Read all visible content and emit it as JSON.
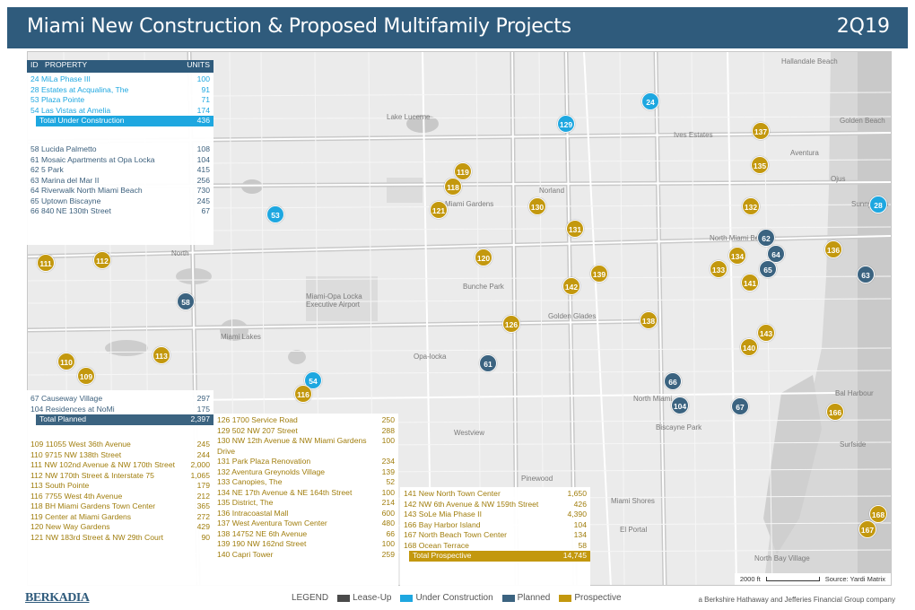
{
  "header": {
    "title": "Miami New Construction & Proposed Multifamily Projects",
    "quarter": "2Q19"
  },
  "map": {
    "places": [
      "Hallandale Beach",
      "Lake Lucerne",
      "Ives Estates",
      "Golden Beach",
      "Aventura",
      "Norland",
      "Ojus",
      "Miami Gardens",
      "Sunny Isles",
      "North Miami Beach",
      "North",
      "Bunche Park",
      "Golden Glades",
      "Miami-Opa Locka Executive Airport",
      "Miami Lakes",
      "Opa-locka",
      "Westview",
      "North Miami",
      "Biscayne Park",
      "Bal Harbour",
      "Surfside",
      "Pinewood",
      "Miami Shores",
      "El Portal",
      "North Bay Village"
    ],
    "pins": [
      {
        "id": "24",
        "status": "uc"
      },
      {
        "id": "129",
        "status": "uc"
      },
      {
        "id": "137",
        "status": "pr"
      },
      {
        "id": "135",
        "status": "pr"
      },
      {
        "id": "119",
        "status": "pr"
      },
      {
        "id": "118",
        "status": "pr"
      },
      {
        "id": "53",
        "status": "uc"
      },
      {
        "id": "121",
        "status": "pr"
      },
      {
        "id": "130",
        "status": "pr"
      },
      {
        "id": "132",
        "status": "pr"
      },
      {
        "id": "28",
        "status": "uc"
      },
      {
        "id": "131",
        "status": "pr"
      },
      {
        "id": "62",
        "status": "pl"
      },
      {
        "id": "111",
        "status": "pr"
      },
      {
        "id": "112",
        "status": "pr"
      },
      {
        "id": "120",
        "status": "pr"
      },
      {
        "id": "134",
        "status": "pr"
      },
      {
        "id": "64",
        "status": "pl"
      },
      {
        "id": "136",
        "status": "pr"
      },
      {
        "id": "133",
        "status": "pr"
      },
      {
        "id": "65",
        "status": "pl"
      },
      {
        "id": "63",
        "status": "pl"
      },
      {
        "id": "139",
        "status": "pr"
      },
      {
        "id": "142",
        "status": "pr"
      },
      {
        "id": "141",
        "status": "pr"
      },
      {
        "id": "58",
        "status": "pl"
      },
      {
        "id": "126",
        "status": "pr"
      },
      {
        "id": "138",
        "status": "pr"
      },
      {
        "id": "143",
        "status": "pr"
      },
      {
        "id": "140",
        "status": "pr"
      },
      {
        "id": "110",
        "status": "pr"
      },
      {
        "id": "113",
        "status": "pr"
      },
      {
        "id": "61",
        "status": "pl"
      },
      {
        "id": "109",
        "status": "pr"
      },
      {
        "id": "54",
        "status": "uc"
      },
      {
        "id": "66",
        "status": "pl"
      },
      {
        "id": "116",
        "status": "pr"
      },
      {
        "id": "104",
        "status": "pl"
      },
      {
        "id": "67",
        "status": "pl"
      },
      {
        "id": "166",
        "status": "pr"
      },
      {
        "id": "168",
        "status": "pr"
      },
      {
        "id": "167",
        "status": "pr"
      }
    ],
    "scale": {
      "label": "2000 ft",
      "source": "Source: Yardi Matrix"
    }
  },
  "table_top": {
    "columns": {
      "id": "ID",
      "property": "PROPERTY",
      "units": "UNITS"
    },
    "under_construction": [
      {
        "id": "24",
        "name": "MiLa Phase III",
        "units": "100"
      },
      {
        "id": "28",
        "name": "Estates at Acqualina, The",
        "units": "91"
      },
      {
        "id": "53",
        "name": "Plaza Pointe",
        "units": "71"
      },
      {
        "id": "54",
        "name": "Las Vistas at Amelia",
        "units": "174"
      }
    ],
    "total_uc": {
      "label": "Total Under Construction",
      "units": "436"
    },
    "planned": [
      {
        "id": "58",
        "name": "Lucida Palmetto",
        "units": "108"
      },
      {
        "id": "61",
        "name": "Mosaic Apartments at Opa Locka",
        "units": "104"
      },
      {
        "id": "62",
        "name": "5 Park",
        "units": "415"
      },
      {
        "id": "63",
        "name": "Marina del Mar II",
        "units": "256"
      },
      {
        "id": "64",
        "name": "Riverwalk North Miami Beach",
        "units": "730"
      },
      {
        "id": "65",
        "name": "Uptown Biscayne",
        "units": "245"
      },
      {
        "id": "66",
        "name": "840 NE 130th Street",
        "units": "67"
      }
    ]
  },
  "table_bottom_left": {
    "planned": [
      {
        "id": "67",
        "name": "Causeway Village",
        "units": "297"
      },
      {
        "id": "104",
        "name": "Residences at NoMi",
        "units": "175"
      }
    ],
    "total_pl": {
      "label": "Total Planned",
      "units": "2,397"
    },
    "prospective": [
      {
        "id": "109",
        "name": "11055 West 36th Avenue",
        "units": "245"
      },
      {
        "id": "110",
        "name": "9715 NW 138th Street",
        "units": "244"
      },
      {
        "id": "111",
        "name": "NW 102nd Avenue & NW 170th Street",
        "units": "2,000"
      },
      {
        "id": "112",
        "name": "NW 170th Street & Interstate 75",
        "units": "1,065"
      },
      {
        "id": "113",
        "name": "South Pointe",
        "units": "179"
      },
      {
        "id": "116",
        "name": "7755 West 4th Avenue",
        "units": "212"
      },
      {
        "id": "118",
        "name": "BH Miami Gardens Town Center",
        "units": "365"
      },
      {
        "id": "119",
        "name": "Center at Miami Gardens",
        "units": "272"
      },
      {
        "id": "120",
        "name": "New Way Gardens",
        "units": "429"
      },
      {
        "id": "121",
        "name": "NW 183rd Street & NW 29th Court",
        "units": "90"
      }
    ]
  },
  "table_bottom_mid": {
    "prospective": [
      {
        "id": "126",
        "name": "1700 Service Road",
        "units": "250"
      },
      {
        "id": "129",
        "name": "502 NW 207 Street",
        "units": "288"
      },
      {
        "id": "130",
        "name": "NW 12th Avenue & NW Miami Gardens Drive",
        "units": "100"
      },
      {
        "id": "131",
        "name": "Park Plaza Renovation",
        "units": "234"
      },
      {
        "id": "132",
        "name": "Aventura Greynolds Village",
        "units": "139"
      },
      {
        "id": "133",
        "name": "Canopies, The",
        "units": "52"
      },
      {
        "id": "134",
        "name": "NE 17th Avenue & NE 164th Street",
        "units": "100"
      },
      {
        "id": "135",
        "name": "District, The",
        "units": "214"
      },
      {
        "id": "136",
        "name": "Intracoastal Mall",
        "units": "600"
      },
      {
        "id": "137",
        "name": "West Aventura Town Center",
        "units": "480"
      },
      {
        "id": "138",
        "name": "14752 NE 6th Avenue",
        "units": "66"
      },
      {
        "id": "139",
        "name": "190 NW 162nd Street",
        "units": "100"
      },
      {
        "id": "140",
        "name": "Capri Tower",
        "units": "259"
      }
    ]
  },
  "table_bottom_right": {
    "prospective": [
      {
        "id": "141",
        "name": "New North Town Center",
        "units": "1,650"
      },
      {
        "id": "142",
        "name": "NW 6th Avenue & NW 159th Street",
        "units": "426"
      },
      {
        "id": "143",
        "name": "SoLe Mia Phase II",
        "units": "4,390"
      },
      {
        "id": "166",
        "name": "Bay Harbor Island",
        "units": "104"
      },
      {
        "id": "167",
        "name": "North Beach Town Center",
        "units": "134"
      },
      {
        "id": "168",
        "name": "Ocean Terrace",
        "units": "58"
      }
    ],
    "total_pr": {
      "label": "Total Prospective",
      "units": "14,745"
    }
  },
  "footer": {
    "logo": "BERKADIA",
    "legend_title": "LEGEND",
    "legend": [
      {
        "label": "Lease-Up",
        "color": "#4a4a4a"
      },
      {
        "label": "Under Construction",
        "color": "#1ea7e0"
      },
      {
        "label": "Planned",
        "color": "#3b6380"
      },
      {
        "label": "Prospective",
        "color": "#c3980e"
      }
    ],
    "company": "a Berkshire Hathaway and Jefferies Financial Group company"
  },
  "colors": {
    "header": "#2f5b7c",
    "under_construction": "#1ea7e0",
    "planned": "#3b6380",
    "prospective": "#c3980e"
  }
}
